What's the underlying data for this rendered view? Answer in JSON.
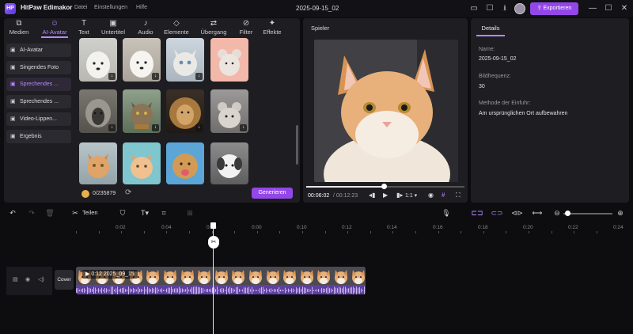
{
  "titlebar": {
    "logo": "HP",
    "app_name": "HitPaw Edimakor",
    "menu": [
      "Datei",
      "Einstellungen",
      "Hilfe"
    ],
    "doc_title": "2025-09-15_02",
    "export_label": "Exportieren",
    "icons": [
      "layout-icon",
      "feedback-icon",
      "download-icon",
      "avatar",
      "minimize-icon",
      "maximize-icon",
      "close-icon"
    ]
  },
  "toolbar": {
    "items": [
      {
        "label": "Medien",
        "icon": "media-icon"
      },
      {
        "label": "AI-Avatar",
        "icon": "ai-avatar-icon"
      },
      {
        "label": "Text",
        "icon": "text-icon"
      },
      {
        "label": "Untertitel",
        "icon": "subtitle-icon"
      },
      {
        "label": "Audio",
        "icon": "audio-icon"
      },
      {
        "label": "Elemente",
        "icon": "elements-icon"
      },
      {
        "label": "Übergang",
        "icon": "transition-icon"
      },
      {
        "label": "Filter",
        "icon": "filter-icon"
      },
      {
        "label": "Effekte",
        "icon": "effects-icon"
      }
    ],
    "active": "AI-Avatar"
  },
  "sidebar": {
    "items": [
      {
        "label": "AI-Avatar",
        "active": false
      },
      {
        "label": "Singendes Foto",
        "active": false
      },
      {
        "label": "Sprechendes ...",
        "active": true
      },
      {
        "label": "Sprechendes ...",
        "active": false
      },
      {
        "label": "Video-Lippen...",
        "active": false
      },
      {
        "label": "Ergebnis",
        "active": false
      }
    ]
  },
  "gallery": {
    "items": [
      "samoyed-dog",
      "white-puppy",
      "white-cat",
      "hamster",
      "sheep",
      "tabby-cat",
      "lion",
      "chinchilla",
      "orange-tabby-cat",
      "ginger-kitten",
      "golden-retriever",
      "white-dog"
    ]
  },
  "footer": {
    "credits": "0/235879",
    "generate_label": "Generieren"
  },
  "player": {
    "title": "Spieler",
    "current_time": "00:06:02",
    "total_time": "00:12:23",
    "separator": "/",
    "speed": "1:1",
    "progress": 0.49
  },
  "details": {
    "tab": "Details",
    "fields": [
      {
        "label": "Name:",
        "value": "2025-09-15_02"
      },
      {
        "label": "Bildfrequenz:",
        "value": "30"
      },
      {
        "label": "Methode der Einfuhr:",
        "value": "Am ursprünglichen Ort aufbewahren"
      }
    ]
  },
  "timeline": {
    "split_label": "Teilen",
    "ruler": [
      "00:00",
      "0:02",
      "0:04",
      "0:06",
      "0:08",
      "0:10",
      "0:12",
      "0:14",
      "0:16",
      "0:18",
      "0:20",
      "0:22",
      "0:24"
    ],
    "ruler_visible": [
      "0:02",
      "0:04",
      "0:06",
      "0:00",
      "0:10",
      "0:12",
      "0:14",
      "0:16",
      "0:18",
      "0:20",
      "0:22",
      "0:24"
    ],
    "cover_label": "Cover",
    "clip_label": "0:12 2025_09_15",
    "zoom": 0.05
  },
  "colors": {
    "accent": "#9447e8",
    "accent_light": "#b889ff",
    "clip": "#5b3d93",
    "panel": "#1d1d22"
  }
}
